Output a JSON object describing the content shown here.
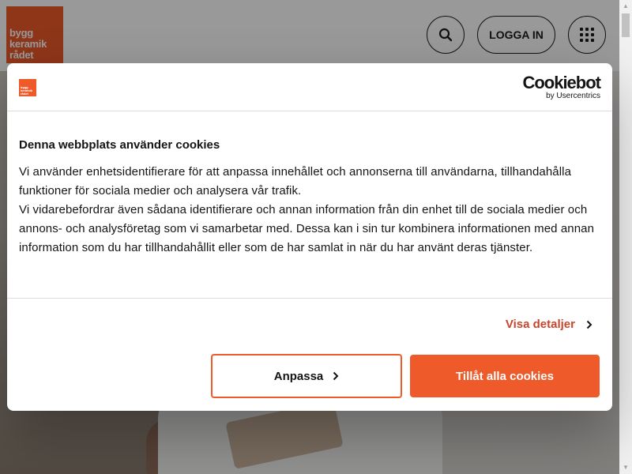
{
  "header": {
    "logo_lines": [
      "bygg",
      "keramik",
      "rådet"
    ],
    "login_label": "LOGGA IN",
    "search_icon": "search-icon",
    "menu_icon": "grid-menu-icon"
  },
  "cookie_dialog": {
    "mini_logo_lines": [
      "bygg",
      "keramik",
      "rådet"
    ],
    "brand": "Cookiebot",
    "brand_sub": "by Usercentrics",
    "title": "Denna webbplats använder cookies",
    "paragraph_1": "Vi använder enhetsidentifierare för att anpassa innehållet och annonserna till användarna, tillhandahålla funktioner för sociala medier och analysera vår trafik.",
    "paragraph_2": "Vi vidarebefordrar även sådana identifierare och annan information från din enhet till de sociala medier och annons- och analysföretag som vi samarbetar med. Dessa kan i sin tur kombinera informationen med annan information som du har tillhandahållit eller som de har samlat in när du har använt deras tjänster.",
    "details_label": "Visa detaljer",
    "customize_label": "Anpassa",
    "allow_all_label": "Tillåt alla cookies"
  },
  "colors": {
    "brand_orange": "#ef5a2a",
    "link_orange": "#c9462c",
    "text_dark": "#141414"
  }
}
